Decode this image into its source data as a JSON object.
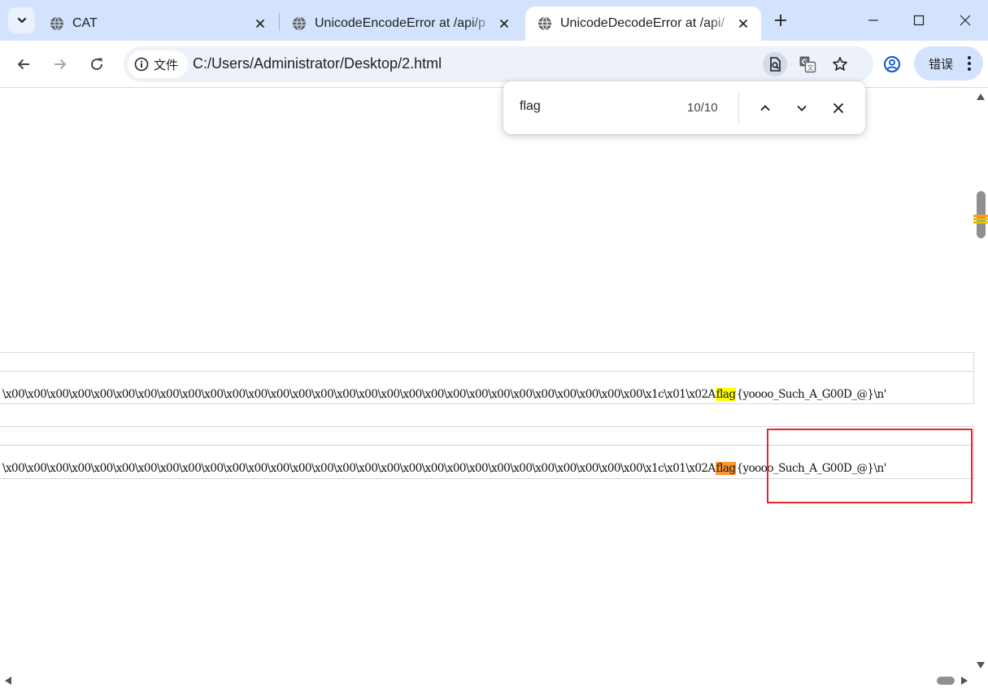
{
  "tabs": [
    {
      "title": "CAT",
      "active": false
    },
    {
      "title": "UnicodeEncodeError at /api/p",
      "active": false
    },
    {
      "title": "UnicodeDecodeError at /api/",
      "active": true
    }
  ],
  "omnibox": {
    "security_chip": "文件",
    "url": "C:/Users/Administrator/Desktop/2.html"
  },
  "profile": {
    "error_label": "错误"
  },
  "find": {
    "query": "flag",
    "count": "10/10"
  },
  "content": {
    "line1": {
      "prefix": "\\x00\\x00\\x00\\x00\\x00\\x00\\x00\\x00\\x00\\x00\\x00\\x00\\x00\\x00\\x00\\x00\\x00\\x00\\x00\\x00\\x00\\x00\\x00\\x00\\x00\\x00\\x00\\x00\\x00\\x1c\\x01\\x02A",
      "match": "flag",
      "suffix": "{yoooo_Such_A_G00D_@}\\n'"
    },
    "line2": {
      "prefix": "\\x00\\x00\\x00\\x00\\x00\\x00\\x00\\x00\\x00\\x00\\x00\\x00\\x00\\x00\\x00\\x00\\x00\\x00\\x00\\x00\\x00\\x00\\x00\\x00\\x00\\x00\\x00\\x00\\x00\\x1c\\x01\\x02A",
      "match": "flag",
      "suffix": "{yoooo_Such_A_G00D_@}\\n'"
    }
  },
  "colors": {
    "tabstrip": "#d3e3fd",
    "match_highlight": "#ffff00",
    "current_match_highlight": "#ff9632",
    "annotation_box": "#e8252b"
  },
  "icons": {
    "tab_search": "chevron-down-icon",
    "favicon": "globe-icon",
    "close": "close-icon",
    "new_tab": "plus-icon",
    "back": "arrow-left-icon",
    "forward": "arrow-right-icon",
    "reload": "reload-icon",
    "info": "info-icon",
    "find_in_page": "find-in-page-icon",
    "translate": "translate-icon",
    "bookmark": "star-icon",
    "profile": "account-icon",
    "menu": "more-vert-icon"
  }
}
